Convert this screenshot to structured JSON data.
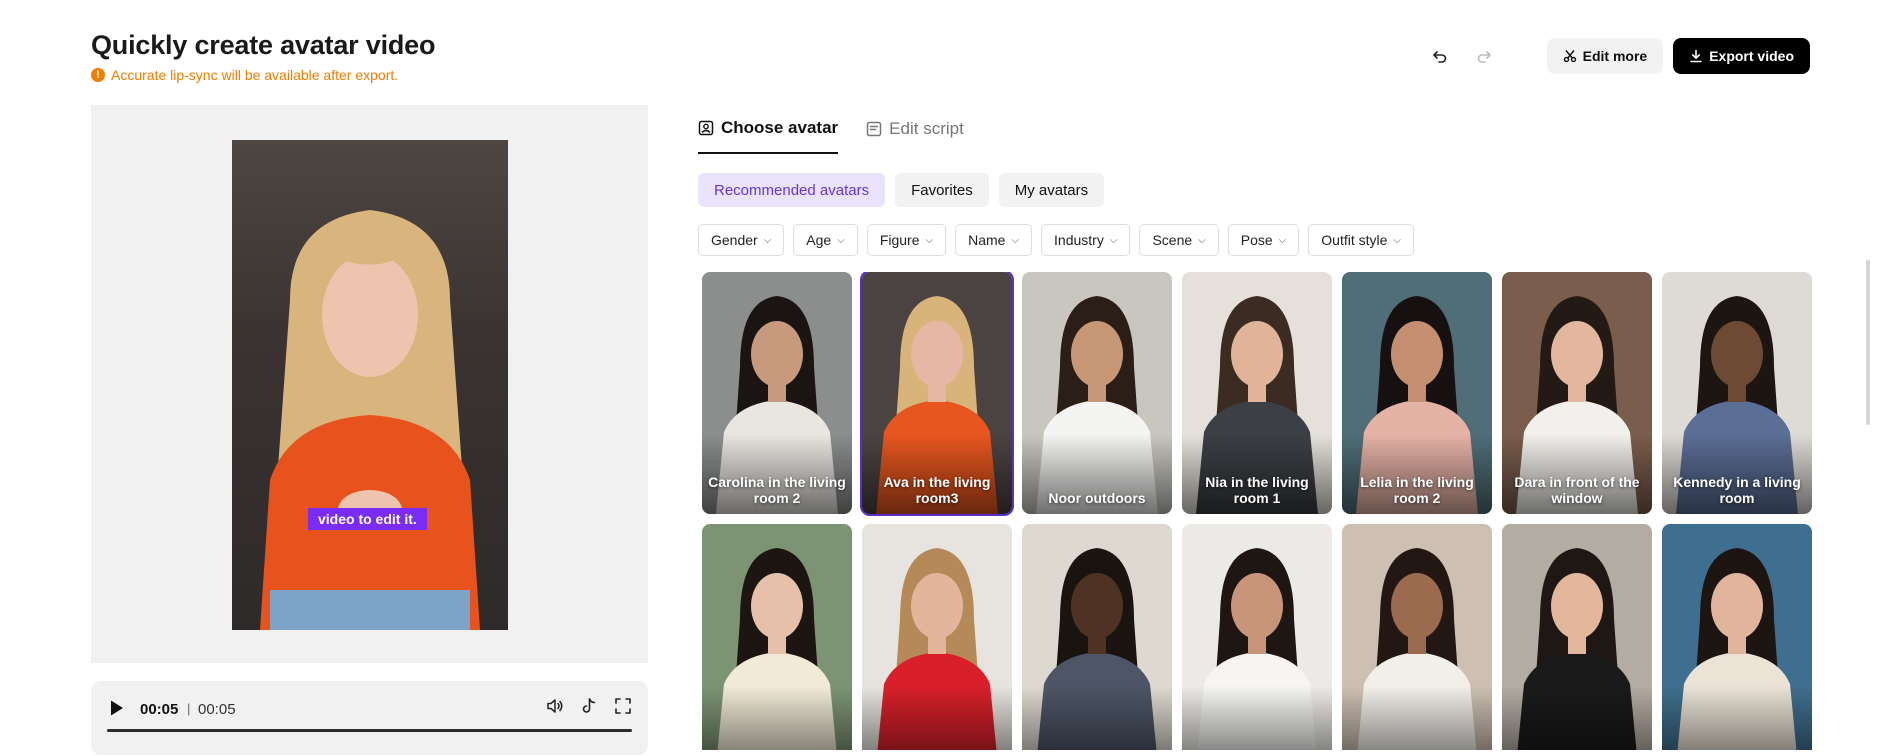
{
  "page": {
    "title": "Quickly create avatar video",
    "warning": "Accurate lip-sync will be available after export."
  },
  "toolbar": {
    "undo_icon": "undo-icon",
    "redo_icon": "redo-icon",
    "edit_more_label": "Edit more",
    "export_label": "Export video"
  },
  "preview": {
    "caption": "video to edit it."
  },
  "player": {
    "current_time": "00:05",
    "total_time": "00:05",
    "separator": "|"
  },
  "tabs": [
    {
      "label": "Choose avatar",
      "icon": "avatar-icon",
      "active": true
    },
    {
      "label": "Edit script",
      "icon": "script-icon",
      "active": false
    }
  ],
  "categories": [
    {
      "label": "Recommended avatars",
      "active": true
    },
    {
      "label": "Favorites",
      "active": false
    },
    {
      "label": "My avatars",
      "active": false
    }
  ],
  "filters": [
    "Gender",
    "Age",
    "Figure",
    "Name",
    "Industry",
    "Scene",
    "Pose",
    "Outfit style"
  ],
  "avatars": [
    {
      "label": "Carolina in the living room 2",
      "bg": "#8b8e8c",
      "skin": "#c79a7e",
      "hair": "#1a1412",
      "shirt": "#e9e6e1",
      "selected": false
    },
    {
      "label": "Ava in the living room3",
      "bg": "#4a4341",
      "skin": "#e6b7a4",
      "hair": "#d8b47a",
      "shirt": "#e8561f",
      "selected": true
    },
    {
      "label": "Noor outdoors",
      "bg": "#c9c6bf",
      "skin": "#c89775",
      "hair": "#2b1e17",
      "shirt": "#f4f4f2",
      "selected": false
    },
    {
      "label": "Nia in the living room 1",
      "bg": "#e5e1da",
      "skin": "#e1b49a",
      "hair": "#3b2b22",
      "shirt": "#3c3f44",
      "selected": false
    },
    {
      "label": "Lelia in the living room 2",
      "bg": "#4f6e78",
      "skin": "#c48f71",
      "hair": "#161110",
      "shirt": "#e5b2a6",
      "selected": false
    },
    {
      "label": "Dara in front of the window",
      "bg": "#7a5d4c",
      "skin": "#e2b79e",
      "hair": "#231a16",
      "shirt": "#f2f0ec",
      "selected": false
    },
    {
      "label": "Kennedy in a living room",
      "bg": "#dedad4",
      "skin": "#6e4a35",
      "hair": "#1c1512",
      "shirt": "#5b6e96",
      "selected": false
    },
    {
      "label": "",
      "bg": "#7d9474",
      "skin": "#e6c0a8",
      "hair": "#1d1512",
      "shirt": "#f1ead6",
      "selected": false
    },
    {
      "label": "",
      "bg": "#e7e4df",
      "skin": "#e3b59a",
      "hair": "#b58a58",
      "shirt": "#d9202a",
      "selected": false
    },
    {
      "label": "",
      "bg": "#ded9d0",
      "skin": "#4e3224",
      "hair": "#1a1411",
      "shirt": "#4d5566",
      "selected": false
    },
    {
      "label": "",
      "bg": "#eceae6",
      "skin": "#c8957a",
      "hair": "#1e1612",
      "shirt": "#f6f5f2",
      "selected": false
    },
    {
      "label": "",
      "bg": "#cdbfb2",
      "skin": "#9c6a4e",
      "hair": "#221712",
      "shirt": "#f2efe9",
      "selected": false
    },
    {
      "label": "",
      "bg": "#b3aca2",
      "skin": "#e2b79c",
      "hair": "#1f1713",
      "shirt": "#1a1a1a",
      "selected": false
    },
    {
      "label": "",
      "bg": "#3f6f8e",
      "skin": "#e0b59c",
      "hair": "#1c1512",
      "shirt": "#eae3d6",
      "selected": false
    }
  ],
  "player_icons": [
    "volume-icon",
    "tiktok-icon",
    "fullscreen-icon"
  ]
}
